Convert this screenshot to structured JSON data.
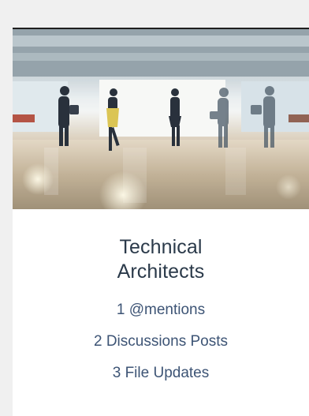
{
  "card": {
    "title": "Technical Architects",
    "image_alt": "people walking in a bright office corridor",
    "stats": [
      {
        "label": "1 @mentions"
      },
      {
        "label": "2 Discussions Posts"
      },
      {
        "label": "3 File Updates"
      }
    ]
  },
  "colors": {
    "page_background": "#f0f0f0",
    "card_background": "#ffffff",
    "card_top_border": "#1f1f1f",
    "title": "#2b3a4a",
    "stat_link": "#3d5475"
  }
}
